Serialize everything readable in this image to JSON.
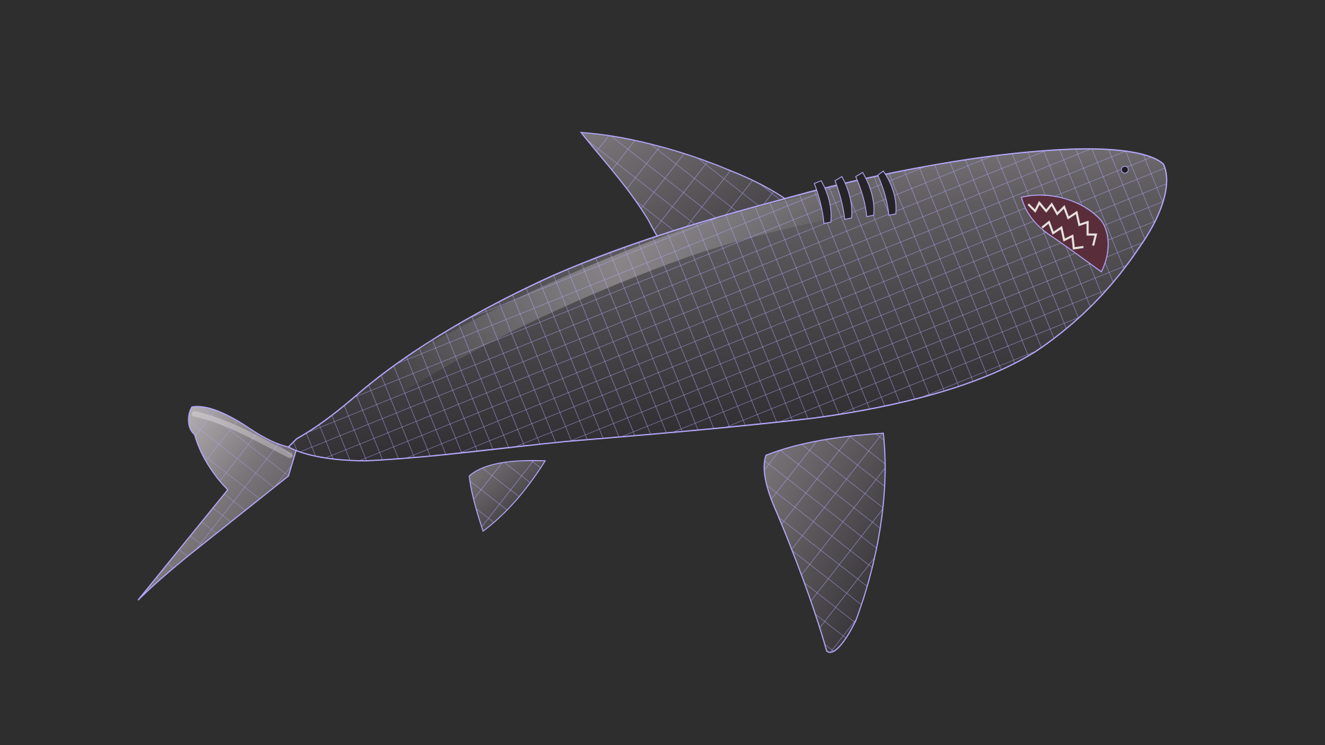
{
  "scene": {
    "subject": "shark-wireframe",
    "colors": {
      "background": "#2e2e2e",
      "skin_dark": "#3d3b3d",
      "skin_mid": "#6f6c6f",
      "skin_light": "#b9b4b6",
      "wire": "#b7aaff",
      "mouth": "#5a2d3a",
      "teeth": "#e7e3df",
      "gill": "#262426"
    }
  }
}
